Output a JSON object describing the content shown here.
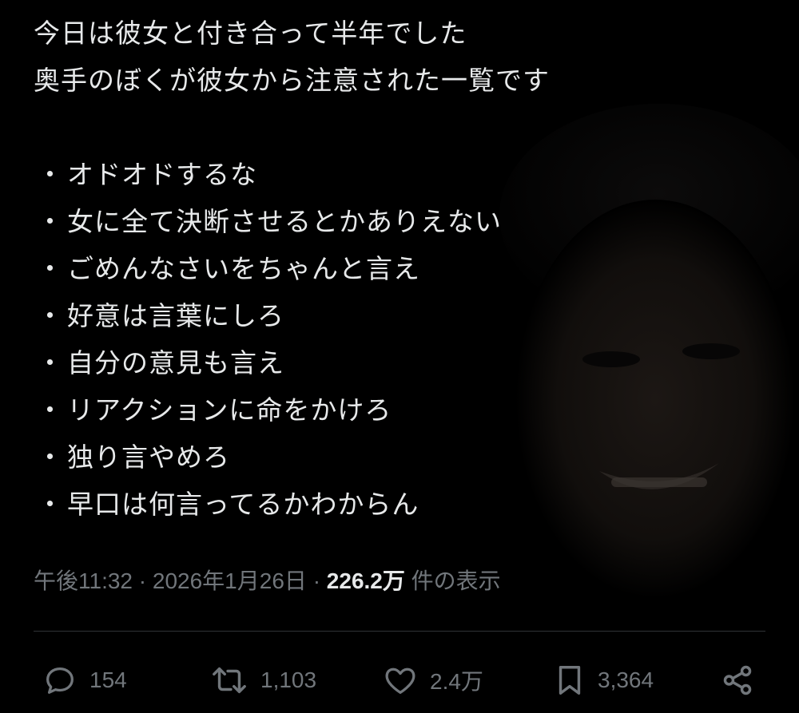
{
  "tweet": {
    "intro_lines": [
      "今日は彼女と付き合って半年でした",
      "奥手のぼくが彼女から注意された一覧です"
    ],
    "bullet_symbol": "・",
    "items": [
      "オドオドするな",
      "女に全て決断させるとかありえない",
      "ごめんなさいをちゃんと言え",
      "好意は言葉にしろ",
      "自分の意見も言え",
      "リアクションに命をかけろ",
      "独り言やめろ",
      "早口は何言ってるかわからん"
    ]
  },
  "meta": {
    "time": "午後11:32",
    "separator": "·",
    "date": "2026年1月26日",
    "views_count": "226.2万",
    "views_label": "件の表示"
  },
  "actions": {
    "reply_count": "154",
    "retweet_count": "1,103",
    "like_count": "2.4万",
    "bookmark_count": "3,364"
  },
  "colors": {
    "background": "#000000",
    "text": "#e7e9ea",
    "muted": "#71767b",
    "divider": "#2f3336"
  }
}
